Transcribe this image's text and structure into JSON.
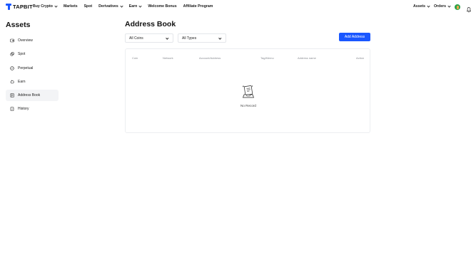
{
  "brand": {
    "name": "TAPBIT",
    "accent": "#1a57ff"
  },
  "nav": {
    "items": [
      {
        "label": "Buy Crypto",
        "dropdown": true
      },
      {
        "label": "Markets",
        "dropdown": false
      },
      {
        "label": "Spot",
        "dropdown": false
      },
      {
        "label": "Derivatives",
        "dropdown": true
      },
      {
        "label": "Earn",
        "dropdown": true
      },
      {
        "label": "Welcome Bonus",
        "dropdown": false
      },
      {
        "label": "Affiliate Program",
        "dropdown": false
      }
    ],
    "right": {
      "assets_label": "Assets",
      "orders_label": "Orders",
      "avatar_icon": "user-avatar-icon",
      "bell_icon": "bell-icon"
    }
  },
  "sidebar": {
    "title": "Assets",
    "items": [
      {
        "label": "Overview",
        "icon": "wallet-icon",
        "active": false
      },
      {
        "label": "Spot",
        "icon": "coins-icon",
        "active": false
      },
      {
        "label": "Perpetual",
        "icon": "perpetual-icon",
        "active": false
      },
      {
        "label": "Earn",
        "icon": "piggy-bank-icon",
        "active": false
      },
      {
        "label": "Address Book",
        "icon": "address-book-icon",
        "active": true
      },
      {
        "label": "History",
        "icon": "history-icon",
        "active": false
      }
    ]
  },
  "main": {
    "title": "Address Book",
    "filters": {
      "coins_value": "All Coins",
      "types_value": "All Types"
    },
    "add_button_label": "Add Address",
    "table": {
      "columns": [
        "Coin",
        "Network",
        "Account/Address",
        "Tag/Memo",
        "Address name",
        "Action"
      ],
      "empty_text": "No Record"
    }
  }
}
